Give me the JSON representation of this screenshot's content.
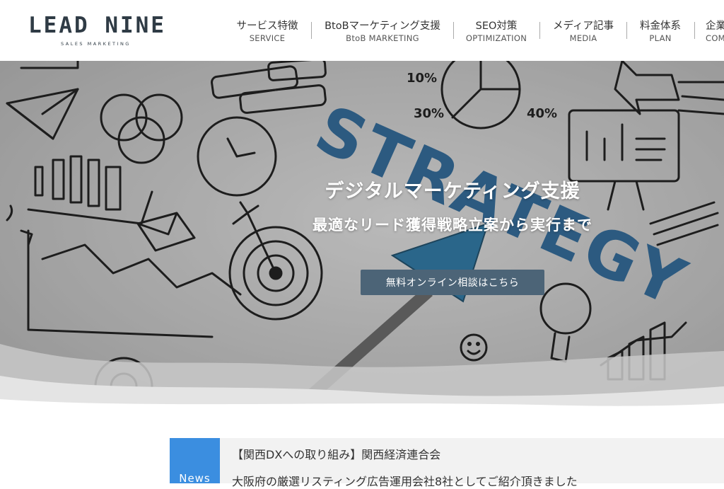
{
  "logo": {
    "main": "LEAD NINE",
    "sub": "SALES MARKETING"
  },
  "nav": [
    {
      "jp": "サービス特徴",
      "en": "SERVICE"
    },
    {
      "jp": "BtoBマーケティング支援",
      "en": "BtoB MARKETING"
    },
    {
      "jp": "SEO対策",
      "en": "OPTIMIZATION"
    },
    {
      "jp": "メディア記事",
      "en": "MEDIA"
    },
    {
      "jp": "料金体系",
      "en": "PLAN"
    },
    {
      "jp": "企業",
      "en": "COM"
    }
  ],
  "hero": {
    "title": "デジタルマーケティング支援",
    "subtitle": "最適なリード獲得戦略立案から実行まで",
    "cta": "無料オンライン相談はこちら",
    "background_word": "STRATEGY",
    "background_labels": [
      "10%",
      "30%",
      "40%"
    ]
  },
  "news": {
    "label": "News",
    "title": "【関西DXへの取り組み】関西経済連合会",
    "body": "大阪府の厳選リスティング広告運用会社8社としてご紹介頂きました"
  },
  "colors": {
    "logo": "#2f3b45",
    "cta_bg": "#4c6477",
    "news_label_bg": "#3b8ee0",
    "news_bg": "#f2f2f2",
    "strategy_blue": "#2f6ea3"
  }
}
